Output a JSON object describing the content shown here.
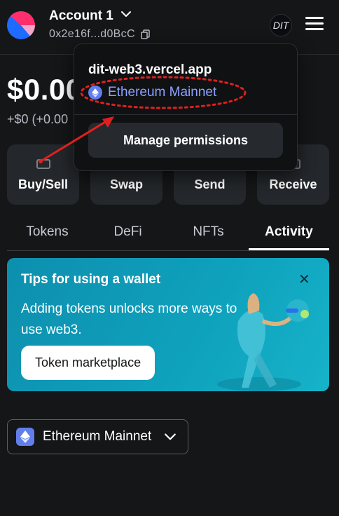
{
  "header": {
    "account_name": "Account 1",
    "address": "0x2e16f...d0BcC",
    "site_badge_text": "DIT",
    "icons": [
      "avatar",
      "chevron-down-icon",
      "copy-icon",
      "menu-icon"
    ]
  },
  "balance": {
    "amount": "$0.00",
    "change": "+$0 (+0.00"
  },
  "actions": [
    {
      "label": "Buy/Sell",
      "icon": "buy-sell-icon"
    },
    {
      "label": "Swap",
      "icon": "swap-icon"
    },
    {
      "label": "Send",
      "icon": "send-icon"
    },
    {
      "label": "Receive",
      "icon": "receive-icon"
    }
  ],
  "tabs": [
    {
      "label": "Tokens",
      "active": false
    },
    {
      "label": "DeFi",
      "active": false
    },
    {
      "label": "NFTs",
      "active": false
    },
    {
      "label": "Activity",
      "active": true
    }
  ],
  "tips": {
    "title": "Tips for using a wallet",
    "body": "Adding tokens unlocks more ways to use web3.",
    "button": "Token marketplace"
  },
  "network_selector": {
    "label": "Ethereum Mainnet"
  },
  "popover": {
    "site": "dit-web3.vercel.app",
    "network": "Ethereum Mainnet",
    "manage_button": "Manage permissions"
  },
  "colors": {
    "background": "#141618",
    "tip_card": "#0fa2bd",
    "network_text": "#8da2ff",
    "annotation_red": "#e0201e"
  }
}
